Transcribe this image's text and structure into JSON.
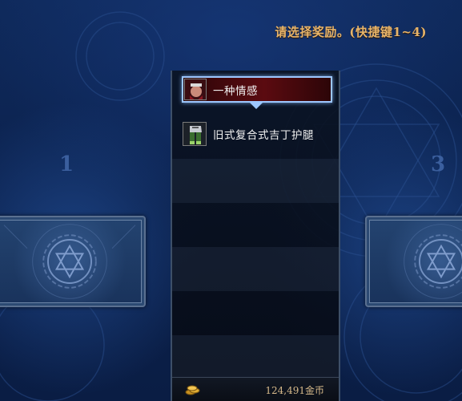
{
  "header": {
    "prompt": "请选择奖励。(快捷键1~4)"
  },
  "slots": {
    "left_number": "1",
    "right_number": "3"
  },
  "reward_list": {
    "items": [
      {
        "name": "一种情感",
        "icon": "character-portrait-icon",
        "selected": true
      },
      {
        "name": "旧式复合式吉丁护腿",
        "icon": "leg-armor-icon",
        "selected": false
      }
    ]
  },
  "footer": {
    "gold": "124,491金币",
    "icon": "gold-coins-icon"
  },
  "colors": {
    "title_gold": "#e7b46a",
    "selection_border": "#9cc7ff",
    "selection_fill": "#5b0b10",
    "background": "#0c2350"
  }
}
